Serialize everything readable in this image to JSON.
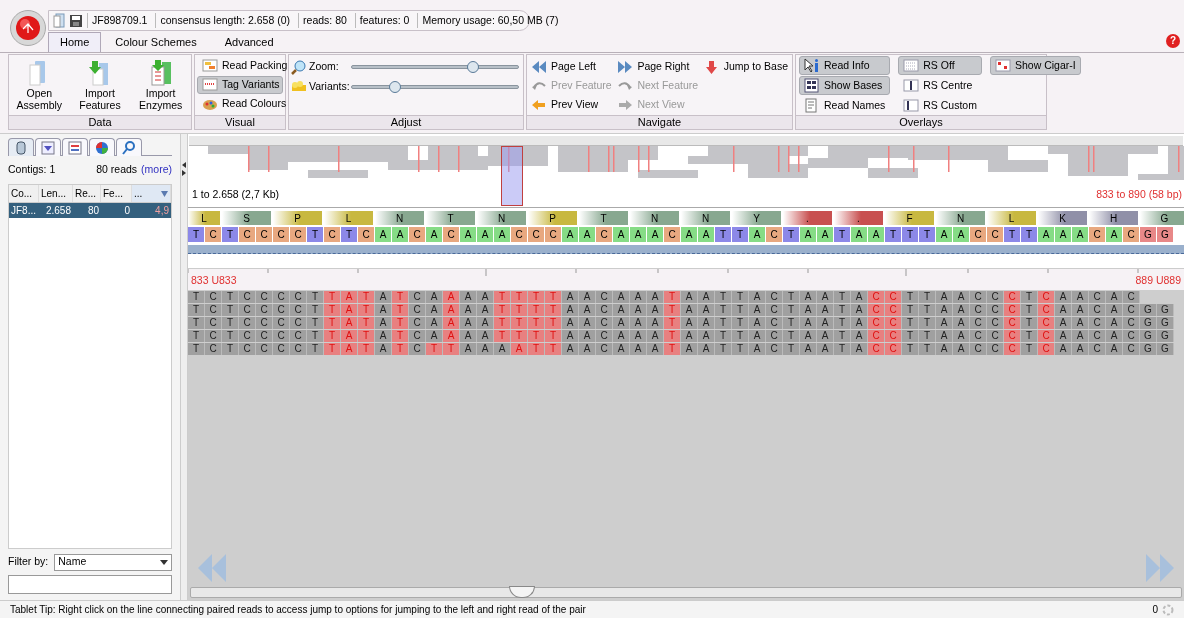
{
  "title_bar": {
    "contig": "JF898709.1",
    "consensus_length": "consensus length: 2.658 (0)",
    "reads": "reads: 80",
    "features": "features: 0",
    "memory": "Memory usage: 60,50 MB (7)"
  },
  "tabs": [
    {
      "label": "Home",
      "selected": true
    },
    {
      "label": "Colour Schemes",
      "selected": false
    },
    {
      "label": "Advanced",
      "selected": false
    }
  ],
  "help": "?",
  "ribbon": {
    "data": {
      "label": "Data",
      "buttons": [
        {
          "label": "Open Assembly"
        },
        {
          "label": "Import Features"
        },
        {
          "label": "Import Enzymes"
        }
      ]
    },
    "visual": {
      "label": "Visual",
      "buttons": [
        {
          "label": "Read Packing",
          "selected": false
        },
        {
          "label": "Tag Variants",
          "selected": true
        },
        {
          "label": "Read Colours",
          "selected": false
        }
      ]
    },
    "adjust": {
      "label": "Adjust",
      "sliders": [
        {
          "label": "Zoom:",
          "level": 0.73
        },
        {
          "label": "Variants:",
          "level": 0.26
        }
      ]
    },
    "navigate": {
      "label": "Navigate",
      "columns": [
        [
          {
            "label": "Page Left",
            "disabled": false
          },
          {
            "label": "Prev Feature",
            "disabled": true
          },
          {
            "label": "Prev View",
            "disabled": false
          }
        ],
        [
          {
            "label": "Page Right",
            "disabled": false
          },
          {
            "label": "Next Feature",
            "disabled": true
          },
          {
            "label": "Next View",
            "disabled": true
          }
        ],
        [
          {
            "label": "Jump to Base",
            "disabled": false
          }
        ]
      ]
    },
    "overlays": {
      "label": "Overlays",
      "columns": [
        [
          {
            "label": "Read Info",
            "selected": true
          },
          {
            "label": "Show Bases",
            "selected": true
          },
          {
            "label": "Read Names",
            "selected": false
          }
        ],
        [
          {
            "label": "RS Off",
            "selected": true
          },
          {
            "label": "RS Centre",
            "selected": false
          },
          {
            "label": "RS Custom",
            "selected": false
          }
        ],
        [
          {
            "label": "Show Cigar-I",
            "selected": true
          }
        ]
      ]
    }
  },
  "side_panel": {
    "tabs": [
      {
        "selected": true
      },
      {
        "selected": false
      },
      {
        "selected": false
      },
      {
        "selected": false
      },
      {
        "selected": false
      }
    ],
    "contigs": "Contigs: 1",
    "reads": "80 reads",
    "more": "(more)",
    "table": {
      "columns": [
        {
          "label": "Co...",
          "sorted": false
        },
        {
          "label": "Len...",
          "sorted": false
        },
        {
          "label": "Re...",
          "sorted": false
        },
        {
          "label": "Fe...",
          "sorted": false
        },
        {
          "label": "...",
          "sorted": true
        }
      ],
      "rows": [
        {
          "cells": [
            "JF8...",
            "2.658",
            "80",
            "0",
            "4,9"
          ],
          "selected": true
        }
      ]
    },
    "filter_label": "Filter by:",
    "filter_value": "Name"
  },
  "overview": {
    "range": "1 to 2.658 (2,7 Kb)",
    "view_range": "833 to 890 (58 bp)"
  },
  "translation": [
    {
      "aa": "L",
      "color": "#c8b840"
    },
    {
      "aa": "S",
      "color": "#88a890"
    },
    {
      "aa": "P",
      "color": "#c8b840"
    },
    {
      "aa": "L",
      "color": "#c8b840"
    },
    {
      "aa": "N",
      "color": "#88a890"
    },
    {
      "aa": "T",
      "color": "#88a890"
    },
    {
      "aa": "N",
      "color": "#88a890"
    },
    {
      "aa": "P",
      "color": "#c8b840"
    },
    {
      "aa": "T",
      "color": "#88a890"
    },
    {
      "aa": "N",
      "color": "#88a890"
    },
    {
      "aa": "N",
      "color": "#88a890"
    },
    {
      "aa": "Y",
      "color": "#88a890"
    },
    {
      "aa": ".",
      "color": "#c85050"
    },
    {
      "aa": ".",
      "color": "#c85050"
    },
    {
      "aa": "F",
      "color": "#c8b840"
    },
    {
      "aa": "N",
      "color": "#88a890"
    },
    {
      "aa": "L",
      "color": "#c8b840"
    },
    {
      "aa": "K",
      "color": "#9090a8"
    },
    {
      "aa": "H",
      "color": "#9090a8"
    },
    {
      "aa": "G",
      "color": "#88a890"
    }
  ],
  "consensus": [
    "T",
    "C",
    "T",
    "C",
    "C",
    "C",
    "C",
    "T",
    "C",
    "T",
    "C",
    "A",
    "A",
    "C",
    "A",
    "C",
    "A",
    "A",
    "A",
    "C",
    "C",
    "C",
    "A",
    "A",
    "C",
    "A",
    "A",
    "A",
    "C",
    "A",
    "A",
    "T",
    "T",
    "A",
    "C",
    "T",
    "A",
    "A",
    "T",
    "A",
    "A",
    "T",
    "T",
    "T",
    "A",
    "A",
    "C",
    "C",
    "T",
    "T",
    "A",
    "A",
    "A",
    "C",
    "A",
    "C",
    "G",
    "G"
  ],
  "scale": {
    "start": "833 U833",
    "end": "889 U889"
  },
  "reads": [
    [
      "T",
      "C",
      "T",
      "C",
      "C",
      "C",
      "C",
      "T",
      "T",
      "A",
      "T",
      "A",
      "T",
      "C",
      "A",
      "A",
      "A",
      "A",
      "T",
      "T",
      "T",
      "T",
      "A",
      "A",
      "C",
      "A",
      "A",
      "A",
      "T",
      "A",
      "A",
      "T",
      "T",
      "A",
      "C",
      "T",
      "A",
      "A",
      "T",
      "A",
      "C",
      "C",
      "T",
      "T",
      "A",
      "A",
      "C",
      "C",
      "C",
      "T",
      "C",
      "A",
      "A",
      "C",
      "A",
      "C"
    ],
    [
      "T",
      "C",
      "T",
      "C",
      "C",
      "C",
      "C",
      "T",
      "T",
      "A",
      "T",
      "A",
      "T",
      "C",
      "A",
      "A",
      "A",
      "A",
      "T",
      "T",
      "T",
      "T",
      "A",
      "A",
      "C",
      "A",
      "A",
      "A",
      "T",
      "A",
      "A",
      "T",
      "T",
      "A",
      "C",
      "T",
      "A",
      "A",
      "T",
      "A",
      "C",
      "C",
      "T",
      "T",
      "A",
      "A",
      "C",
      "C",
      "C",
      "T",
      "C",
      "A",
      "A",
      "C",
      "A",
      "C",
      "G",
      "G"
    ],
    [
      "T",
      "C",
      "T",
      "C",
      "C",
      "C",
      "C",
      "T",
      "T",
      "A",
      "T",
      "A",
      "T",
      "C",
      "A",
      "A",
      "A",
      "A",
      "T",
      "T",
      "T",
      "T",
      "A",
      "A",
      "C",
      "A",
      "A",
      "A",
      "T",
      "A",
      "A",
      "T",
      "T",
      "A",
      "C",
      "T",
      "A",
      "A",
      "T",
      "A",
      "C",
      "C",
      "T",
      "T",
      "A",
      "A",
      "C",
      "C",
      "C",
      "T",
      "C",
      "A",
      "A",
      "C",
      "A",
      "C",
      "G",
      "G"
    ],
    [
      "T",
      "C",
      "T",
      "C",
      "C",
      "C",
      "C",
      "T",
      "T",
      "A",
      "T",
      "A",
      "T",
      "C",
      "A",
      "A",
      "A",
      "A",
      "T",
      "T",
      "T",
      "T",
      "A",
      "A",
      "C",
      "A",
      "A",
      "A",
      "T",
      "A",
      "A",
      "T",
      "T",
      "A",
      "C",
      "T",
      "A",
      "A",
      "T",
      "A",
      "C",
      "C",
      "T",
      "T",
      "A",
      "A",
      "C",
      "C",
      "C",
      "T",
      "C",
      "A",
      "A",
      "C",
      "A",
      "C",
      "G",
      "G"
    ],
    [
      "T",
      "C",
      "T",
      "C",
      "C",
      "C",
      "C",
      "T",
      "T",
      "A",
      "T",
      "A",
      "T",
      "C",
      "T",
      "T",
      "A",
      "A",
      "A",
      "A",
      "T",
      "T",
      "A",
      "A",
      "C",
      "A",
      "A",
      "A",
      "T",
      "A",
      "A",
      "T",
      "T",
      "A",
      "C",
      "T",
      "A",
      "A",
      "T",
      "A",
      "C",
      "C",
      "T",
      "T",
      "A",
      "A",
      "C",
      "C",
      "C",
      "T",
      "C",
      "A",
      "A",
      "C",
      "A",
      "C",
      "G",
      "G"
    ]
  ],
  "status_bar": {
    "tip": "Tablet Tip: Right click on the line connecting paired reads to access jump to options for jumping to the left and right read of the pair",
    "count": "0"
  }
}
